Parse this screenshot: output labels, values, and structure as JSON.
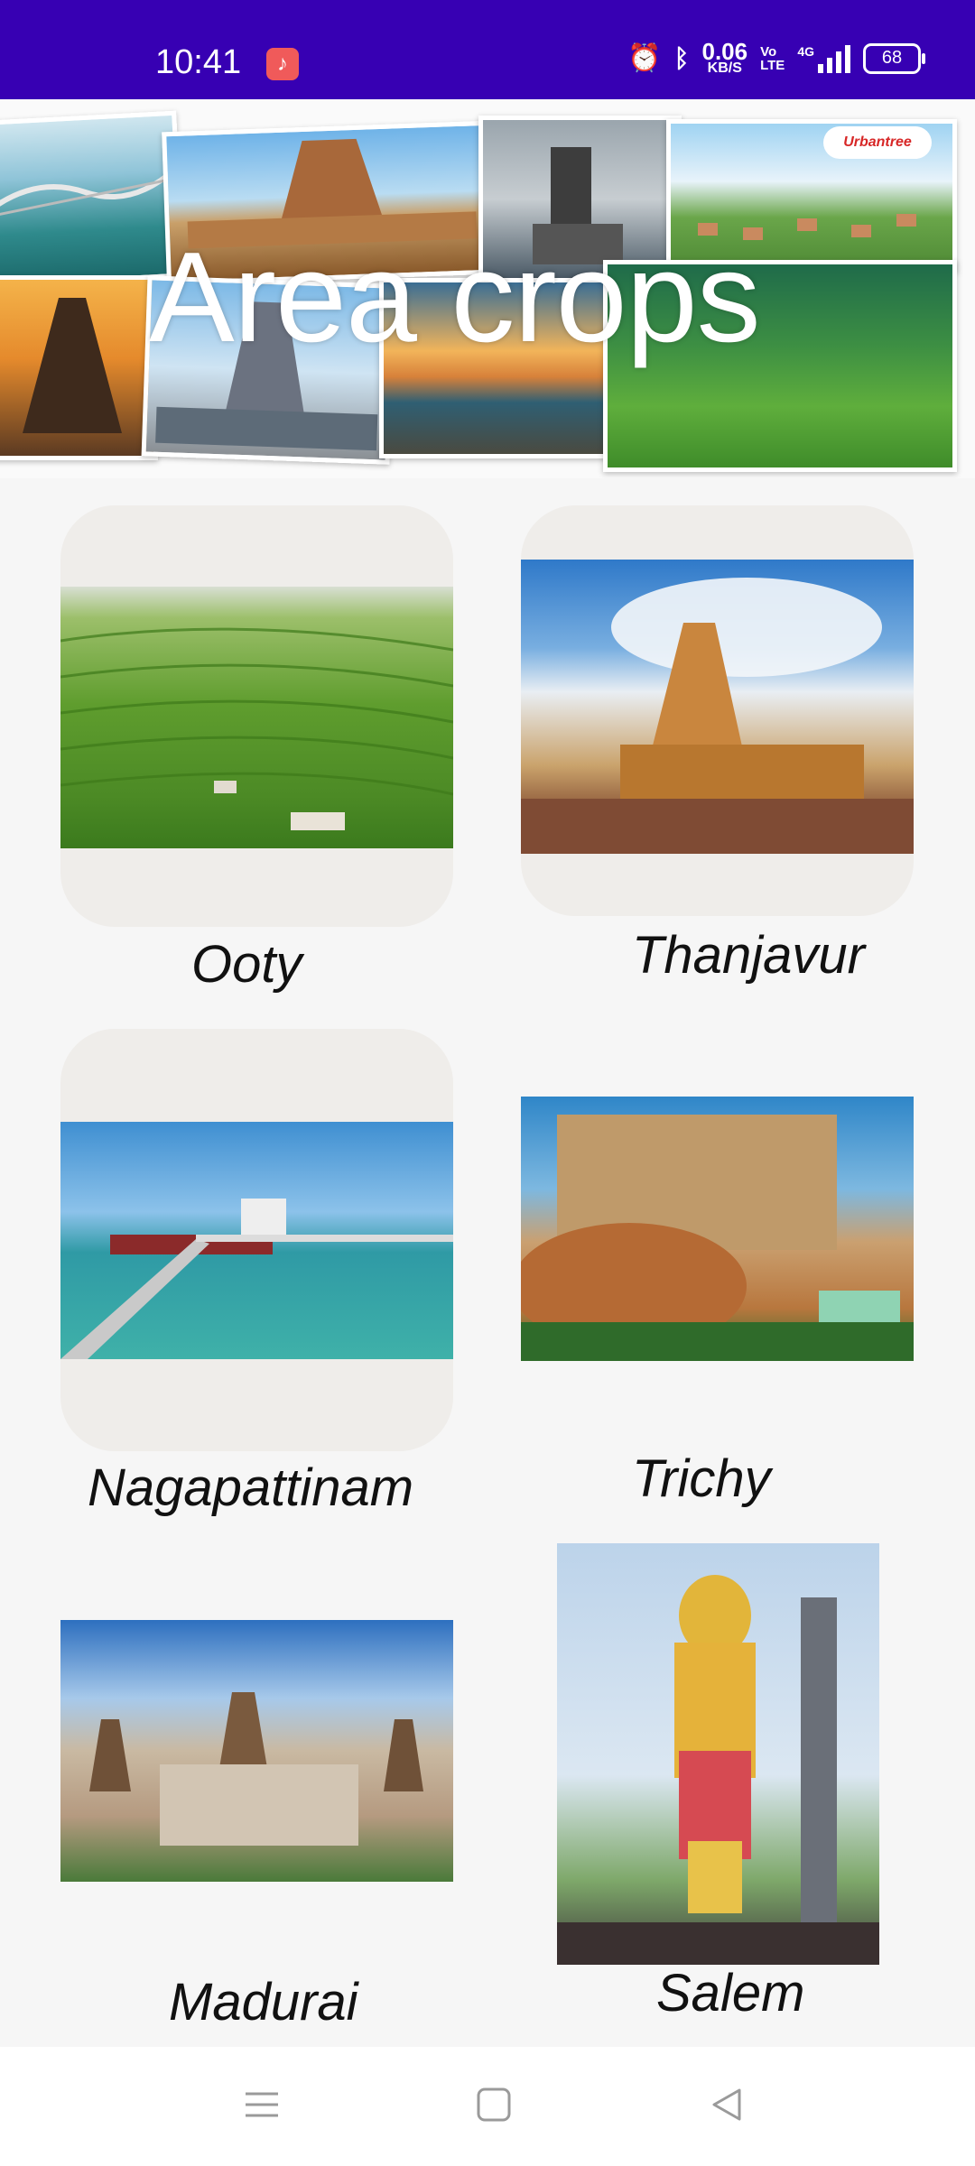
{
  "status_bar": {
    "time": "10:41",
    "net_speed_value": "0.06",
    "net_speed_unit": "KB/S",
    "volte_top": "Vo",
    "volte_bottom": "LTE",
    "network_type": "4G",
    "battery_level": "68",
    "icons": [
      "music-icon",
      "alarm-icon",
      "bluetooth-icon",
      "signal-icon",
      "battery-icon"
    ]
  },
  "banner": {
    "title": "Area crops",
    "logo_text": "Urbantree"
  },
  "places": [
    {
      "name": "Ooty"
    },
    {
      "name": "Thanjavur"
    },
    {
      "name": "Nagapattinam"
    },
    {
      "name": "Trichy"
    },
    {
      "name": "Madurai"
    },
    {
      "name": "Salem"
    }
  ],
  "navigation": {
    "items": [
      "menu-icon",
      "home-icon",
      "back-icon"
    ]
  },
  "colors": {
    "status_bar": "#3700b3",
    "background": "#f6f6f6",
    "card": "#efedea"
  }
}
